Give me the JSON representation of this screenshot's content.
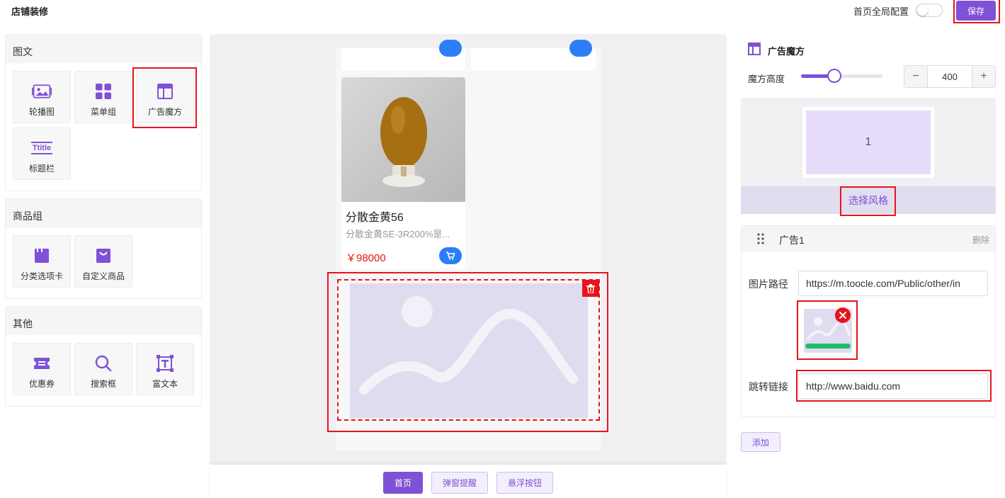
{
  "header": {
    "title": "店铺装修",
    "global_config_label": "首页全局配置",
    "save_label": "保存"
  },
  "components": {
    "graphic": {
      "title": "图文",
      "items": [
        "轮播图",
        "菜单组",
        "广告魔方",
        "标题栏"
      ]
    },
    "goods": {
      "title": "商品组",
      "items": [
        "分类选项卡",
        "自定义商品"
      ]
    },
    "other": {
      "title": "其他",
      "items": [
        "优惠券",
        "搜索框",
        "富文本"
      ]
    },
    "title_icon_text": "Ttitle"
  },
  "preview": {
    "product": {
      "name": "分散金黄56",
      "desc": "分散金黄SE-3R200%是...",
      "price": "￥98000"
    },
    "tabs": [
      "首页",
      "弹窗提醒",
      "悬浮按钮"
    ]
  },
  "settings": {
    "title": "广告魔方",
    "height_label": "魔方高度",
    "height_value": "400",
    "height_slider_fraction": 0.41,
    "minus": "−",
    "plus": "+",
    "layout_cell": "1",
    "choose_style": "选择风格",
    "ad_title": "广告1",
    "delete_label": "删除",
    "image_path_label": "图片路径",
    "image_path_value": "https://m.toocle.com/Public/other/in",
    "link_label": "跳转链接",
    "link_value": "http://www.baidu.com",
    "add_label": "添加"
  },
  "colors": {
    "accent": "#7f51d6",
    "highlight": "#e8141b",
    "price": "#e8141b",
    "cart": "#2c7ef8"
  }
}
